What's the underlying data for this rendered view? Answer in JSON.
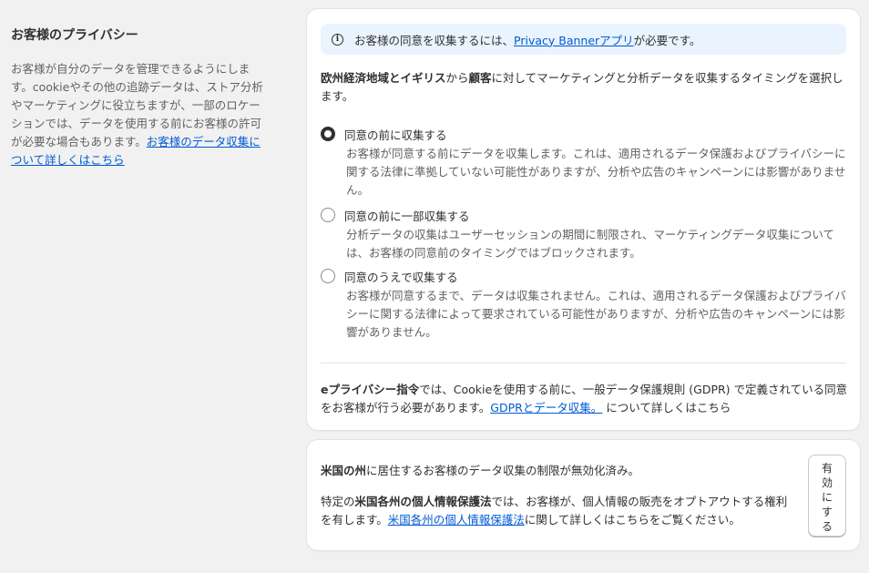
{
  "section": {
    "title": "お客様のプライバシー",
    "description": "お客様が自分のデータを管理できるようにします。cookieやその他の追跡データは、ストア分析やマーケティングに役立ちますが、一部のロケーションでは、データを使用する前にお客様の許可が必要な場合もあります。",
    "learn_more_link": "お客様のデータ収集について詳しくはこちら"
  },
  "banner": {
    "icon": "info-icon",
    "text_before": "お客様の同意を収集するには、",
    "link": "Privacy Bannerアプリ",
    "text_after": "が必要です。"
  },
  "intro": {
    "bold1": "欧州経済地域とイギリス",
    "text1": "から",
    "bold2": "顧客",
    "text2": "に対してマーケティングと分析データを収集するタイミングを選択します。"
  },
  "options": [
    {
      "label": "同意の前に収集する",
      "description": "お客様が同意する前にデータを収集します。これは、適用されるデータ保護およびプライバシーに関する法律に準拠していない可能性がありますが、分析や広告のキャンペーンには影響がありません。",
      "selected": true
    },
    {
      "label": "同意の前に一部収集する",
      "description": "分析データの収集はユーザーセッションの期間に制限され、マーケティングデータ収集については、お客様の同意前のタイミングではブロックされます。",
      "selected": false
    },
    {
      "label": "同意のうえで収集する",
      "description": "お客様が同意するまで、データは収集されません。これは、適用されるデータ保護およびプライバシーに関する法律によって要求されている可能性がありますが、分析や広告のキャンペーンには影響がありません。",
      "selected": false
    }
  ],
  "eprivacy": {
    "bold": "eプライバシー指令",
    "text1": "では、Cookieを使用する前に、一般データ保護規則 (GDPR) で定義されている同意をお客様が行う必要があります。",
    "link": "GDPRとデータ収集。",
    "text2": " について詳しくはこちら"
  },
  "us": {
    "bold1": "米国の州",
    "text1": "に居住するお客様のデータ収集の制限が無効化済み。",
    "text2a": "特定の",
    "bold2": "米国各州の個人情報保護法",
    "text2b": "では、お客様が、個人情報の販売をオプトアウトする権利を有します。",
    "link": "米国各州の個人情報保護法",
    "text2c": "に関して詳しくはこちらをご覧ください。",
    "enable_button": "有効にする"
  },
  "colors": {
    "background": "#f1f1f1",
    "card": "#ffffff",
    "banner": "#eaf4ff",
    "link": "#005bd3",
    "muted_text": "#616161"
  }
}
